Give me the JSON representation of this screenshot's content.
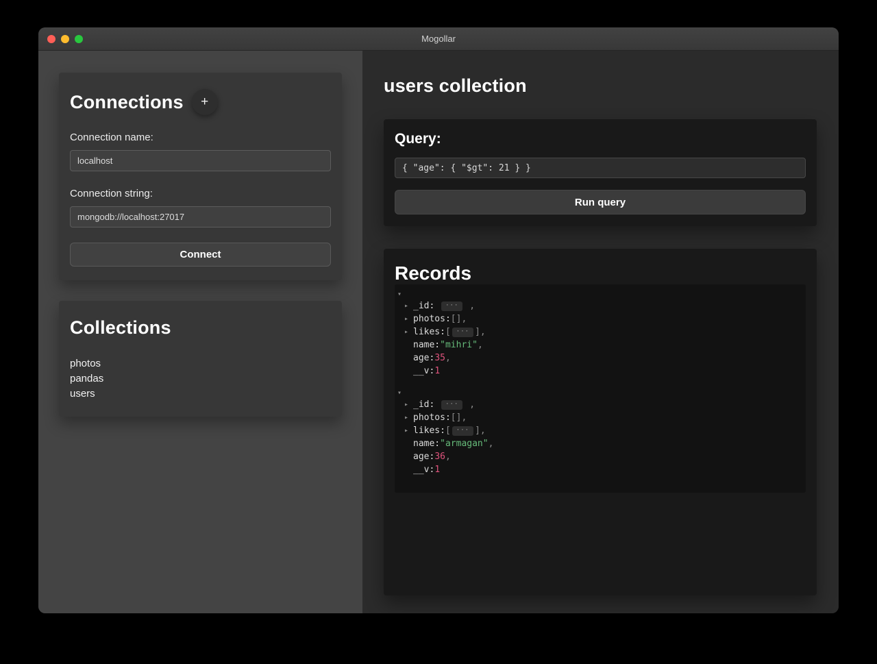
{
  "theme": {
    "string_color": "#66bb7a",
    "number_color": "#e0537d",
    "punct_color": "#8a8a8a",
    "key_color": "#dcdcdc"
  },
  "window": {
    "title": "Mogollar"
  },
  "sidebar": {
    "connections": {
      "title": "Connections",
      "add_button": "+",
      "name_label": "Connection name:",
      "name_value": "localhost",
      "string_label": "Connection string:",
      "string_value": "mongodb://localhost:27017",
      "connect_button": "Connect"
    },
    "collections": {
      "title": "Collections",
      "items": [
        "photos",
        "pandas",
        "users"
      ]
    }
  },
  "main": {
    "page_title": "users collection",
    "query": {
      "title": "Query:",
      "value": "{ \"age\": { \"$gt\": 21 } }",
      "run_button": "Run query"
    },
    "records": {
      "title": "Records",
      "ellipsis_glyph": "···",
      "items": [
        {
          "fields": [
            {
              "key": "_id",
              "sep": ": ",
              "type": "ellipsis",
              "suffix": " ,",
              "expandable": true
            },
            {
              "key": "photos",
              "sep": ":",
              "type": "value",
              "value": "[]",
              "color": "punct",
              "suffix": ",",
              "expandable": true
            },
            {
              "key": "likes",
              "sep": ":",
              "type": "array_ellipsis",
              "suffix": ",",
              "expandable": true
            },
            {
              "key": "name",
              "sep": ":",
              "type": "value",
              "value": "\"mihri\"",
              "color": "string",
              "suffix": ",",
              "expandable": false
            },
            {
              "key": "age",
              "sep": ":",
              "type": "value",
              "value": "35",
              "color": "number",
              "suffix": ",",
              "expandable": false
            },
            {
              "key": "__v",
              "sep": ":",
              "type": "value",
              "value": "1",
              "color": "number",
              "suffix": "",
              "expandable": false
            }
          ]
        },
        {
          "fields": [
            {
              "key": "_id",
              "sep": ": ",
              "type": "ellipsis",
              "suffix": " ,",
              "expandable": true
            },
            {
              "key": "photos",
              "sep": ":",
              "type": "value",
              "value": "[]",
              "color": "punct",
              "suffix": ",",
              "expandable": true
            },
            {
              "key": "likes",
              "sep": ":",
              "type": "array_ellipsis",
              "suffix": ",",
              "expandable": true
            },
            {
              "key": "name",
              "sep": ":",
              "type": "value",
              "value": "\"armagan\"",
              "color": "string",
              "suffix": ",",
              "expandable": false
            },
            {
              "key": "age",
              "sep": ":",
              "type": "value",
              "value": "36",
              "color": "number",
              "suffix": ",",
              "expandable": false
            },
            {
              "key": "__v",
              "sep": ":",
              "type": "value",
              "value": "1",
              "color": "number",
              "suffix": "",
              "expandable": false
            }
          ]
        }
      ]
    }
  }
}
